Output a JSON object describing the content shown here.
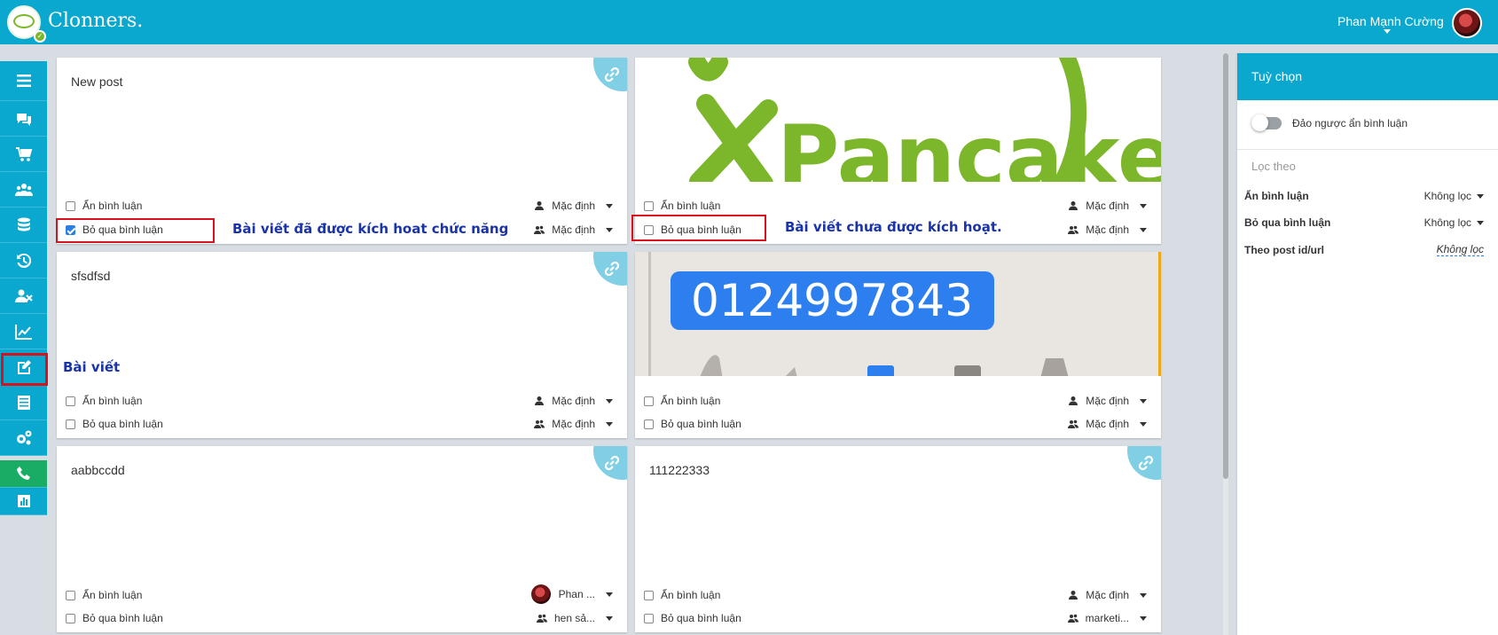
{
  "header": {
    "brand": "Clonners",
    "brand_dot": ".",
    "user_name": "Phan Mạnh Cường"
  },
  "sidebar": {
    "items": [
      {
        "name": "menu-icon"
      },
      {
        "name": "chat-icon"
      },
      {
        "name": "cart-icon"
      },
      {
        "name": "users-icon"
      },
      {
        "name": "database-icon"
      },
      {
        "name": "history-icon"
      },
      {
        "name": "user-block-icon"
      },
      {
        "name": "chart-line-icon"
      },
      {
        "name": "edit-post-icon"
      },
      {
        "name": "list-icon"
      },
      {
        "name": "settings-icon"
      },
      {
        "name": "phone-icon"
      },
      {
        "name": "bar-chart-icon"
      }
    ]
  },
  "labels": {
    "hide_comment": "Ẩn bình luận",
    "skip_comment": "Bỏ qua bình luận"
  },
  "posts": [
    {
      "text": "New post",
      "hide_checked": false,
      "skip_checked": true,
      "hide_value": "Mặc định",
      "skip_value": "Mặc định"
    },
    {
      "text": "",
      "image": "pancake",
      "hide_checked": false,
      "skip_checked": false,
      "hide_value": "Mặc định",
      "skip_value": "Mặc định"
    },
    {
      "text": "sfsdfsd",
      "hide_checked": false,
      "skip_checked": false,
      "hide_value": "Mặc định",
      "skip_value": "Mặc định"
    },
    {
      "text": "",
      "image": "phone",
      "image_text": "0124997843",
      "hide_checked": false,
      "skip_checked": false,
      "hide_value": "Mặc định",
      "skip_value": "Mặc định"
    },
    {
      "text": "aabbccdd",
      "hide_checked": false,
      "skip_checked": false,
      "hide_value": "Phan ...",
      "skip_value": "hen sả..."
    },
    {
      "text": "111222333",
      "hide_checked": false,
      "skip_checked": false,
      "hide_value": "Mặc định",
      "skip_value": "marketi..."
    }
  ],
  "annotations": {
    "activated": "Bài viết đã được kích hoat chức năng",
    "not_activated": "Bài viết chưa được kích hoạt.",
    "post": "Bài viết"
  },
  "pancake_logo_text": "Pancake",
  "panel": {
    "title": "Tuỳ chọn",
    "toggle_label": "Đảo ngược ẩn bình luận",
    "filter_title": "Lọc theo",
    "filters": [
      {
        "label": "Ẩn bình luận",
        "value": "Không lọc"
      },
      {
        "label": "Bỏ qua bình luận",
        "value": "Không lọc"
      },
      {
        "label": "Theo post id/url",
        "value": "Không lọc"
      }
    ]
  },
  "colors": {
    "header": "#0aa8ce",
    "call": "#18ac64",
    "annotation_box": "#d8121c",
    "annotation_text": "#1a33a8",
    "link_badge": "#80cfe4"
  }
}
